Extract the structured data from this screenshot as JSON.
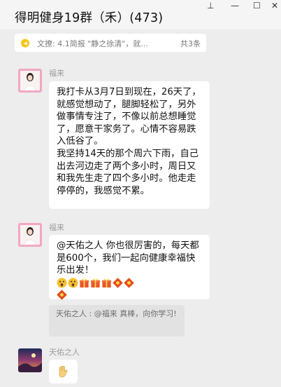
{
  "window": {
    "title": "得明健身19群（禾）(473)",
    "controls": [
      "⊥",
      "—",
      "☐",
      "✕"
    ]
  },
  "announcement": {
    "text": "文撩:  4.1简报 \"静之徐清\"，就...",
    "count": "共3条"
  },
  "messages": [
    {
      "sender": "福来",
      "text": "我打卡从3月7日到现在，26天了，就感觉想动了，腿脚轻松了，另外做事情专注了，不像以前总想睡觉了，愿意干家务了。心情不容易跌入低谷了。\n我坚持14天的那个周六下雨，自己出去河边走了两个多小时，周日又和我先生走了四个多小时。他走走停停的，我感觉不累。"
    },
    {
      "sender": "福来",
      "text": "@天佑之人 你也很厉害的，每天都是600个，我们一起向健康幸福快乐出发！",
      "emojis": [
        "astonished-face",
        "astonished-face",
        "gift",
        "gift",
        "gift",
        "red-envelope-fu",
        "red-envelope-fu",
        "red-envelope-fu"
      ],
      "quote": "天佑之人 : @福来 真棒，向你学习!"
    },
    {
      "sender": "天佑之人",
      "emojis": [
        "waving-hand"
      ]
    }
  ],
  "colors": {
    "background": "#ededed",
    "bubble": "#ffffff",
    "quote": "#e2e2e2",
    "sender_name": "#9b9b9b"
  }
}
